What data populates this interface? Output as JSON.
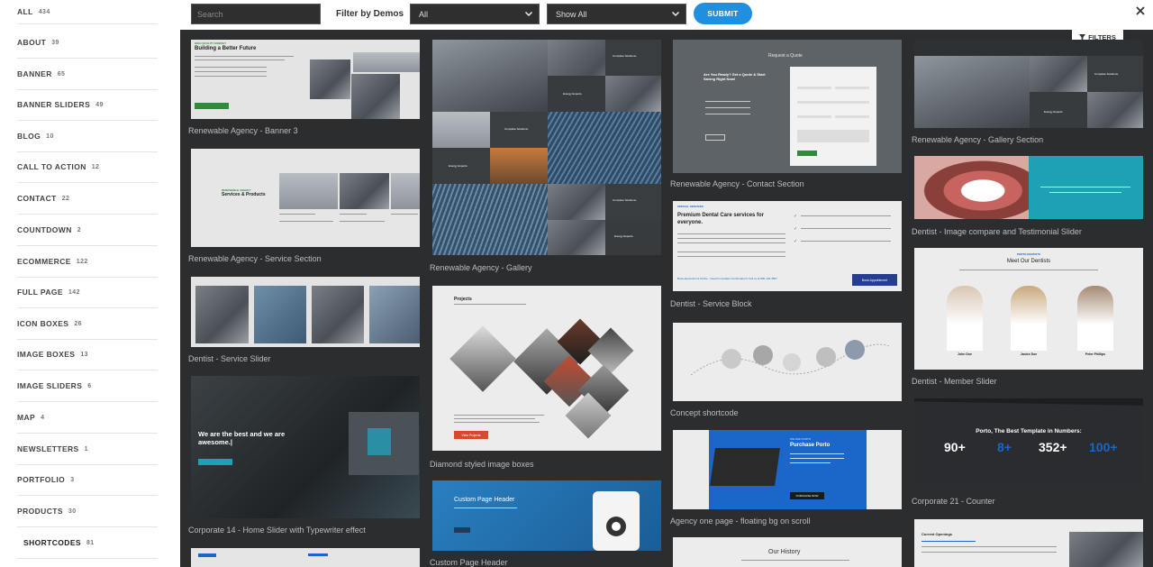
{
  "sidebar": {
    "categories": [
      {
        "label": "ALL",
        "count": "434"
      },
      {
        "label": "ABOUT",
        "count": "39"
      },
      {
        "label": "BANNER",
        "count": "65"
      },
      {
        "label": "BANNER SLIDERS",
        "count": "49"
      },
      {
        "label": "BLOG",
        "count": "10"
      },
      {
        "label": "CALL TO ACTION",
        "count": "12"
      },
      {
        "label": "CONTACT",
        "count": "22"
      },
      {
        "label": "COUNTDOWN",
        "count": "2"
      },
      {
        "label": "ECOMMERCE",
        "count": "122"
      },
      {
        "label": "FULL PAGE",
        "count": "142"
      },
      {
        "label": "ICON BOXES",
        "count": "26"
      },
      {
        "label": "IMAGE BOXES",
        "count": "13"
      },
      {
        "label": "IMAGE SLIDERS",
        "count": "6"
      },
      {
        "label": "MAP",
        "count": "4"
      },
      {
        "label": "NEWSLETTERS",
        "count": "1"
      },
      {
        "label": "PORTFOLIO",
        "count": "3"
      },
      {
        "label": "PRODUCTS",
        "count": "30"
      },
      {
        "label": "SHORTCODES",
        "count": "81"
      }
    ]
  },
  "topbar": {
    "search_placeholder": "Search",
    "filter_label": "Filter by Demos",
    "demo_select": "All",
    "show_select": "Show All",
    "submit_label": "SUBMIT"
  },
  "main": {
    "filters_label": "FILTERS",
    "cards": [
      {
        "caption": "Renewable Agency - Banner 3",
        "headline": "Building a Better Future",
        "tag": "HIGH QUALITY ENERGY"
      },
      {
        "caption": "Renewable Agency - Service Section",
        "headline": "Services & Products",
        "tag": "RENEWABLE AGENCY"
      },
      {
        "caption": "Dentist - Service Slider"
      },
      {
        "caption": "Corporate 14 - Home Slider with Typewriter effect",
        "headline": "We are the best and we are awesome.|"
      },
      {
        "caption": "Renewable Agency - Gallery",
        "tile1": "Complete Solutions.",
        "tile2": "Energy Experts."
      },
      {
        "caption": "Diamond styled image boxes",
        "headline": "Projects",
        "button": "View Projects"
      },
      {
        "caption": "Custom Page Header",
        "headline": "Custom Page Header"
      },
      {
        "caption": "Renewable Agency - Contact Section",
        "headline": "Request a Quote",
        "sub": "Are You Ready? Get a Quote & Start Saving Right Now!"
      },
      {
        "caption": "Dentist - Service Block",
        "tag": "SPECIAL SERVICES",
        "headline": "Premium Dental Care services for everyone.",
        "cta": "Book Appointment Online - Need Immediate Confirmation? Call us at 800-123-4567",
        "button": "Book Appointment"
      },
      {
        "caption": "Concept shortcode"
      },
      {
        "caption": "Agency one page - floating bg on scroll",
        "tag": "WE ARE PORTO",
        "headline": "Purchase Porto",
        "button": "PURCHASE NOW"
      },
      {
        "caption": "Our History"
      },
      {
        "caption": "Renewable Agency - Gallery Section",
        "tile1": "Complete Solutions.",
        "tile2": "Energy Experts."
      },
      {
        "caption": "Dentist - Image compare and Testimonial Slider"
      },
      {
        "caption": "Dentist - Member Slider",
        "tag": "PORTO DENTISTS",
        "headline": "Meet Our Dentists",
        "members": [
          "John Doe",
          "Janice Doe",
          "Peter Phillips"
        ]
      },
      {
        "caption": "Corporate 21 - Counter",
        "headline": "Porto, The Best Template in Numbers:",
        "counters": [
          "90+",
          "8+",
          "352+",
          "100+"
        ]
      },
      {
        "caption": "",
        "headline": "Current Openings"
      }
    ]
  },
  "colors": {
    "accent": "#1f8fe0",
    "panel": "#2b2d2f",
    "caption": "#bdbdbd",
    "green": "#2f8a3a"
  }
}
